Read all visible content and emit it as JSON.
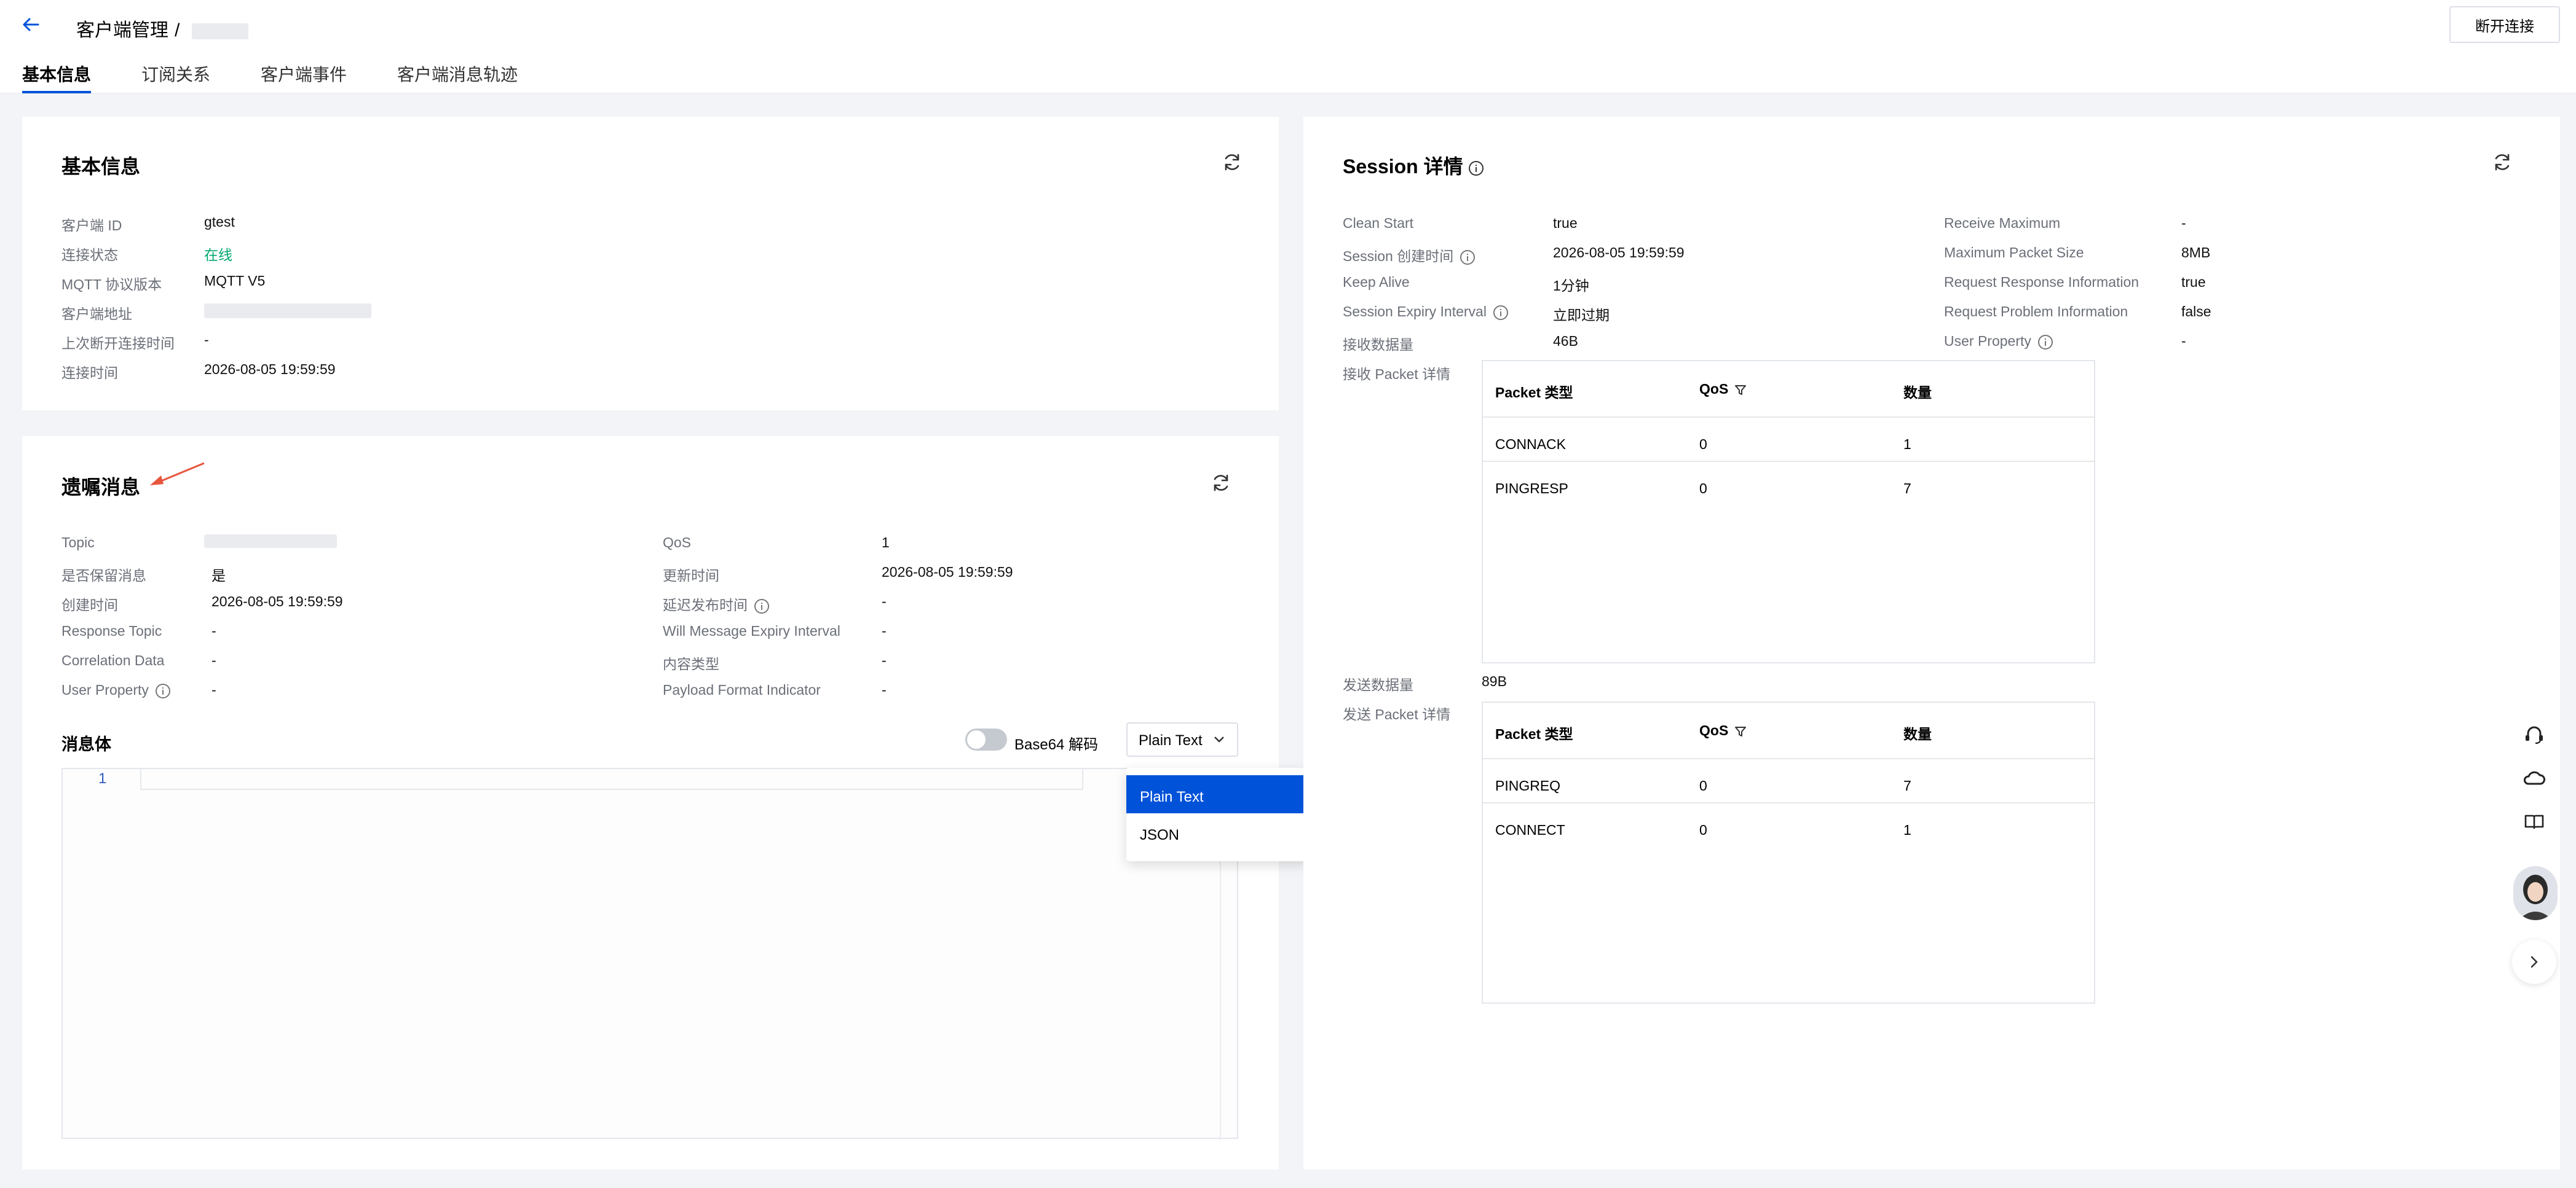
{
  "header": {
    "breadcrumb_root": "客户端管理",
    "breadcrumb_sep": "/",
    "disconnect_label": "断开连接",
    "tabs": [
      "基本信息",
      "订阅关系",
      "客户端事件",
      "客户端消息轨迹"
    ]
  },
  "basic_info": {
    "title": "基本信息",
    "rows": [
      {
        "label": "客户端 ID",
        "value": "gtest"
      },
      {
        "label": "连接状态",
        "value": "在线"
      },
      {
        "label": "MQTT 协议版本",
        "value": "MQTT V5"
      },
      {
        "label": "客户端地址",
        "value": ""
      },
      {
        "label": "上次断开连接时间",
        "value": "-"
      },
      {
        "label": "连接时间",
        "value": "2026-08-05 19:59:59"
      }
    ]
  },
  "will_message": {
    "title": "遗嘱消息",
    "left": [
      {
        "label": "Topic",
        "value": ""
      },
      {
        "label": "是否保留消息",
        "value": "是"
      },
      {
        "label": "创建时间",
        "value": "2026-08-05 19:59:59"
      },
      {
        "label": "Response Topic",
        "value": "-"
      },
      {
        "label": "Correlation Data",
        "value": "-"
      },
      {
        "label": "User Property",
        "value": "-"
      }
    ],
    "right": [
      {
        "label": "QoS",
        "value": "1"
      },
      {
        "label": "更新时间",
        "value": "2026-08-05 19:59:59"
      },
      {
        "label": "延迟发布时间",
        "value": "-"
      },
      {
        "label": "Will Message Expiry Interval",
        "value": "-"
      },
      {
        "label": "内容类型",
        "value": "-"
      },
      {
        "label": "Payload Format Indicator",
        "value": "-"
      }
    ],
    "body_label": "消息体",
    "base64_label": "Base64 解码",
    "format_selected": "Plain Text",
    "format_options": [
      "Plain Text",
      "JSON"
    ],
    "editor_line": "1"
  },
  "session": {
    "title": "Session 详情",
    "left": [
      {
        "label": "Clean Start",
        "value": "true"
      },
      {
        "label": "Session 创建时间",
        "value": "2026-08-05 19:59:59"
      },
      {
        "label": "Keep Alive",
        "value": "1分钟"
      },
      {
        "label": "Session Expiry Interval",
        "value": "立即过期"
      },
      {
        "label": "接收数据量",
        "value": "46B"
      }
    ],
    "right": [
      {
        "label": "Receive Maximum",
        "value": "-"
      },
      {
        "label": "Maximum Packet Size",
        "value": "8MB"
      },
      {
        "label": "Request Response Information",
        "value": "true"
      },
      {
        "label": "Request Problem Information",
        "value": "false"
      },
      {
        "label": "User Property",
        "value": "-"
      }
    ],
    "recv_packet_label": "接收 Packet 详情",
    "sent_amount_label": "发送数据量",
    "sent_amount_value": "89B",
    "sent_packet_label": "发送 Packet 详情",
    "table_headers": [
      "Packet 类型",
      "QoS",
      "数量"
    ],
    "recv_rows": [
      [
        "CONNACK",
        "0",
        "1"
      ],
      [
        "PINGRESP",
        "0",
        "7"
      ]
    ],
    "sent_rows": [
      [
        "PINGREQ",
        "0",
        "7"
      ],
      [
        "CONNECT",
        "0",
        "1"
      ]
    ]
  },
  "colors": {
    "primary": "#0052d9",
    "online": "#00a870",
    "arrow": "#e8553d"
  }
}
